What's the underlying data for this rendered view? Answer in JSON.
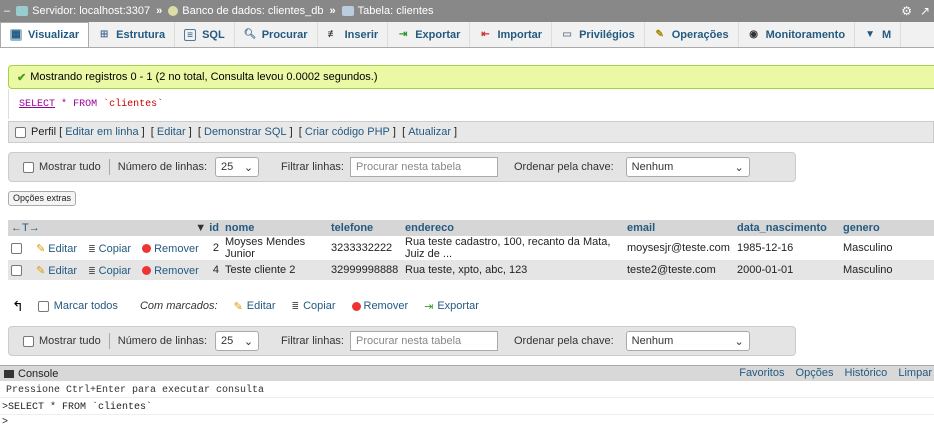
{
  "breadcrumb": {
    "server": "Servidor: localhost:3307",
    "database": "Banco de dados: clientes_db",
    "table": "Tabela: clientes",
    "separator": "»"
  },
  "tabs": [
    {
      "label": "Visualizar",
      "icon": "browse-icon",
      "active": true
    },
    {
      "label": "Estrutura",
      "icon": "structure-icon"
    },
    {
      "label": "SQL",
      "icon": "sql-icon"
    },
    {
      "label": "Procurar",
      "icon": "search-icon"
    },
    {
      "label": "Inserir",
      "icon": "insert-icon"
    },
    {
      "label": "Exportar",
      "icon": "export-icon"
    },
    {
      "label": "Importar",
      "icon": "import-icon"
    },
    {
      "label": "Privilégios",
      "icon": "privileges-icon"
    },
    {
      "label": "Operações",
      "icon": "operations-icon"
    },
    {
      "label": "Monitoramento",
      "icon": "tracking-icon"
    },
    {
      "label": "M",
      "icon": "more-icon"
    }
  ],
  "success_message": "Mostrando registros 0 - 1 (2 no total, Consulta levou 0.0002 segundos.)",
  "sql": {
    "kw": "SELECT",
    "op": "*",
    "from": "FROM",
    "table": "`clientes`"
  },
  "profile_bar": {
    "profile": "Perfil",
    "links": [
      "Editar em linha",
      "Editar",
      "Demonstrar SQL",
      "Criar código PHP",
      "Atualizar"
    ]
  },
  "navbar": {
    "show_all": "Mostrar tudo",
    "rows_label": "Número de linhas:",
    "rows_value": "25",
    "filter_label": "Filtrar linhas:",
    "filter_placeholder": "Procurar nesta tabela",
    "sort_label": "Ordenar pela chave:",
    "sort_value": "Nenhum"
  },
  "extra_options": "Opções extras",
  "table": {
    "arrows": "←T→",
    "columns": [
      "id",
      "nome",
      "telefone",
      "endereco",
      "email",
      "data_nascimento",
      "genero"
    ],
    "actions": {
      "edit": "Editar",
      "copy": "Copiar",
      "remove": "Remover"
    },
    "rows": [
      {
        "id": "2",
        "nome": "Moyses Mendes Junior",
        "telefone": "3233332222",
        "endereco": "Rua teste cadastro, 100, recanto da Mata, Juiz de ...",
        "email": "moysesjr@teste.com",
        "data_nascimento": "1985-12-16",
        "genero": "Masculino"
      },
      {
        "id": "4",
        "nome": "Teste cliente 2",
        "telefone": "32999998888",
        "endereco": "Rua teste, xpto, abc, 123",
        "email": "teste2@teste.com",
        "data_nascimento": "2000-01-01",
        "genero": "Masculino"
      }
    ]
  },
  "with_selected": {
    "mark_all": "Marcar todos",
    "label": "Com marcados:",
    "edit": "Editar",
    "copy": "Copiar",
    "remove": "Remover",
    "export": "Exportar"
  },
  "console": {
    "title": "Console",
    "links": [
      "Favoritos",
      "Opções",
      "Histórico",
      "Limpar"
    ],
    "hint": "Pressione Ctrl+Enter para executar consulta",
    "history": ">SELECT * FROM `clientes`",
    "prompt": ">"
  },
  "colors": {
    "link": "#235a81",
    "success_bg": "#ebf8a4",
    "topbar": "#888888"
  }
}
